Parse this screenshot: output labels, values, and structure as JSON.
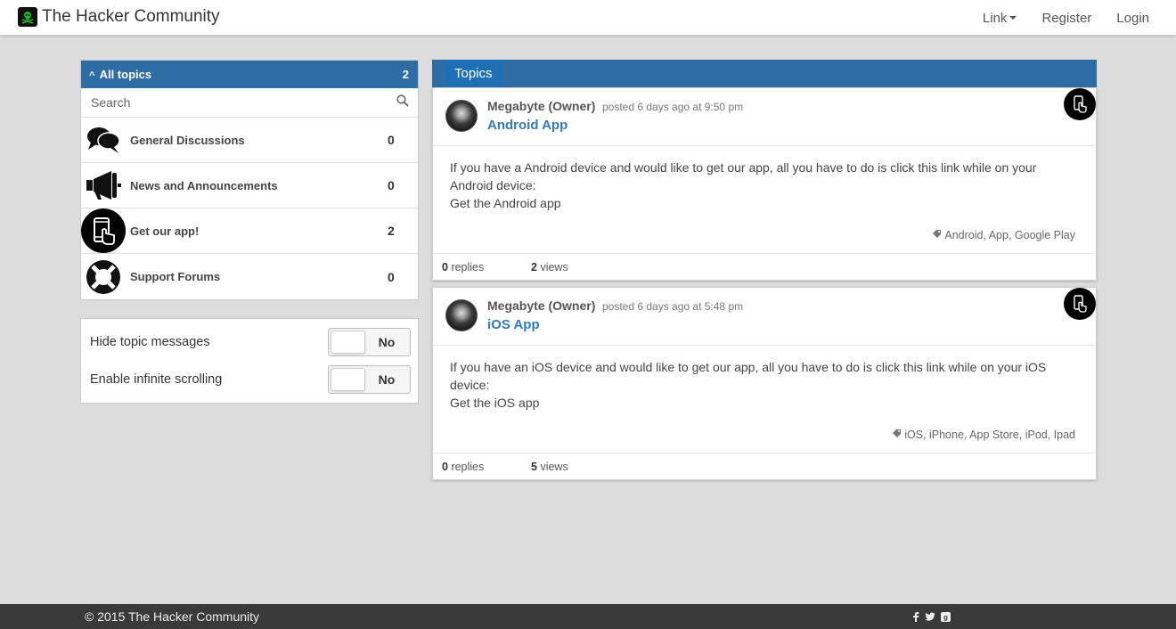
{
  "navbar": {
    "brand": "The Hacker Community",
    "links": {
      "link": "Link",
      "register": "Register",
      "login": "Login"
    }
  },
  "sidebar": {
    "header_label": "All topics",
    "header_count": "2",
    "search_placeholder": "Search",
    "categories": [
      {
        "name": "General Discussions",
        "count": "0",
        "icon": "speech-bubbles-icon"
      },
      {
        "name": "News and Announcements",
        "count": "0",
        "icon": "megaphone-icon"
      },
      {
        "name": "Get our app!",
        "count": "2",
        "icon": "phone-touch-icon"
      },
      {
        "name": "Support Forums",
        "count": "0",
        "icon": "lifebuoy-icon"
      }
    ]
  },
  "options": {
    "hide_topic_messages": {
      "label": "Hide topic messages",
      "value": "No"
    },
    "infinite_scrolling": {
      "label": "Enable infinite scrolling",
      "value": "No"
    }
  },
  "topics": {
    "tab_label": "Topics",
    "items": [
      {
        "author": "Megabyte (Owner)",
        "posted": "posted 6 days ago at 9:50 pm",
        "title": "Android App",
        "body_line1": "If you have a Android device and would like to get our app, all you have to do is click this link while on your",
        "body_line2": "Android device:",
        "body_line3": "Get the Android app",
        "tags": "Android, App, Google Play",
        "replies_count": "0",
        "replies_label": "replies",
        "views_count": "2",
        "views_label": "views"
      },
      {
        "author": "Megabyte (Owner)",
        "posted": "posted 6 days ago at 5:48 pm",
        "title": "iOS App",
        "body_line1": "If you have an iOS device and would like to get our app, all you have to do is click this link while on your iOS",
        "body_line2": "device:",
        "body_line3": "Get the iOS app",
        "tags": "iOS, iPhone, App Store, iPod, Ipad",
        "replies_count": "0",
        "replies_label": "replies",
        "views_count": "5",
        "views_label": "views"
      }
    ]
  },
  "footer": {
    "copyright": "© 2015 The Hacker Community",
    "social_icons": [
      "facebook-icon",
      "twitter-icon",
      "google-plus-icon"
    ]
  },
  "colors": {
    "primary_blue": "#2e6da4",
    "link_blue": "#337ab7",
    "footer_bg": "#3a3a3a",
    "page_bg": "#dcdcdc"
  }
}
